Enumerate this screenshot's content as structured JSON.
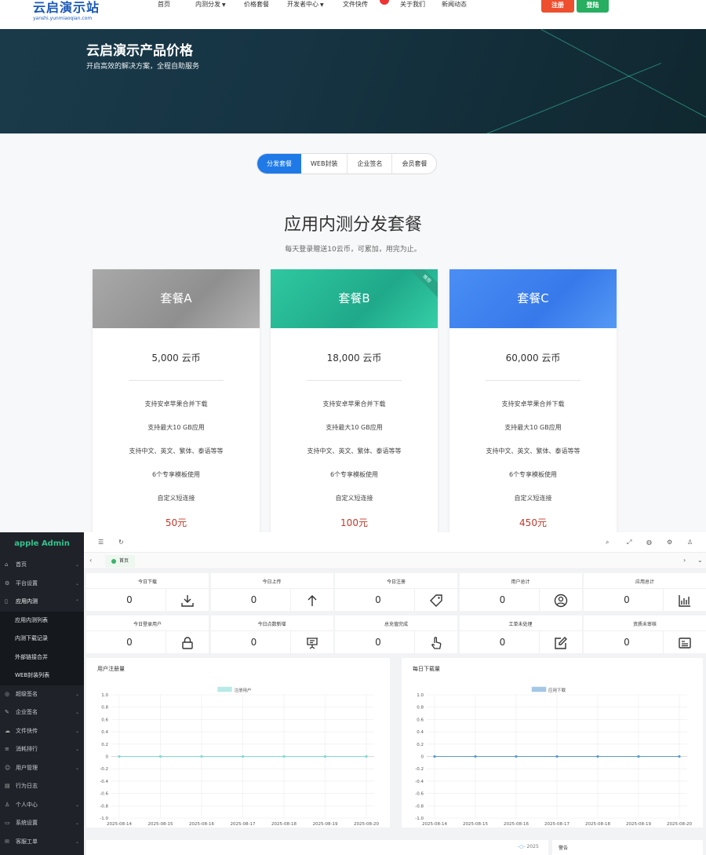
{
  "site": {
    "logo_title": "云启演示站",
    "logo_sub": "yanshi.yunmiaoqian.com",
    "nav": [
      "首页",
      "内测分发",
      "价格套餐",
      "开发者中心",
      "文件快传",
      "关于我们",
      "新闻动态"
    ],
    "register_label": "注册",
    "login_label": "登陆"
  },
  "hero": {
    "title": "云启演示产品价格",
    "subtitle": "开启高效的解决方案，全程自助服务"
  },
  "tabs": [
    "分发套餐",
    "WEB封装",
    "企业签名",
    "会员套餐"
  ],
  "section": {
    "title": "应用内测分发套餐",
    "subtitle": "每天登录赠送10云币，可累加，用完为止。"
  },
  "plans": [
    {
      "name": "套餐A",
      "price": "5,000 云币",
      "cost": "50元",
      "ribbon": ""
    },
    {
      "name": "套餐B",
      "price": "18,000 云币",
      "cost": "100元",
      "ribbon": "推荐"
    },
    {
      "name": "套餐C",
      "price": "60,000 云币",
      "cost": "450元",
      "ribbon": ""
    }
  ],
  "features": [
    "支持安卓苹果合并下载",
    "支持最大10 GB应用",
    "支持中文、英文、繁体、泰语等等",
    "6个专享模板使用",
    "自定义短连接"
  ],
  "admin": {
    "title": "apple Admin",
    "menu": [
      {
        "label": "首页",
        "icon": "home-icon"
      },
      {
        "label": "平台设置",
        "icon": "gear-icon"
      },
      {
        "label": "应用内测",
        "icon": "phone-icon"
      }
    ],
    "submenu": [
      "应用内测列表",
      "内测下载记录",
      "外部链接合并",
      "WEB封装列表"
    ],
    "menu2": [
      "超级签名",
      "企业签名",
      "文件快传",
      "消耗排行",
      "用户管理",
      "行为日志",
      "个人中心",
      "系统设置",
      "客服工单"
    ],
    "home_tab": "首页",
    "stats": [
      {
        "label": "今日下载",
        "value": "0",
        "icon": "download-icon"
      },
      {
        "label": "今日上传",
        "value": "0",
        "icon": "upload-icon"
      },
      {
        "label": "今日注册",
        "value": "0",
        "icon": "tag-icon"
      },
      {
        "label": "用户总计",
        "value": "0",
        "icon": "user-circle-icon"
      },
      {
        "label": "应用总计",
        "value": "0",
        "icon": "bar-chart-icon"
      },
      {
        "label": "今日登录用户",
        "value": "0",
        "icon": "lock-icon"
      },
      {
        "label": "今日点数新增",
        "value": "0",
        "icon": "presentation-icon"
      },
      {
        "label": "总充值完成",
        "value": "0",
        "icon": "hand-pointer-icon"
      },
      {
        "label": "工单未处理",
        "value": "0",
        "icon": "edit-icon"
      },
      {
        "label": "资质未审核",
        "value": "0",
        "icon": "id-card-icon"
      }
    ],
    "bottom_legend": "2025",
    "bottom_title": "警告"
  },
  "chart_data": [
    {
      "type": "line",
      "title": "用户注册量",
      "x": [
        "2025-08-14",
        "2025-08-15",
        "2025-08-16",
        "2025-08-17",
        "2025-08-18",
        "2025-08-19",
        "2025-08-20"
      ],
      "series": [
        {
          "name": "注册用户",
          "values": [
            0,
            0,
            0,
            0,
            0,
            0,
            0
          ]
        }
      ],
      "ylim": [
        -1.0,
        1.0
      ],
      "yticks": [
        "1.0",
        "0.8",
        "0.6",
        "0.4",
        "0.2",
        "0",
        "-0.2",
        "-0.4",
        "-0.6",
        "-0.8",
        "-1.0"
      ],
      "grid": true,
      "legend": "top-center",
      "color": "#7fd9d3"
    },
    {
      "type": "line",
      "title": "每日下载量",
      "x": [
        "2025-08-14",
        "2025-08-15",
        "2025-08-16",
        "2025-08-17",
        "2025-08-18",
        "2025-08-19",
        "2025-08-20"
      ],
      "series": [
        {
          "name": "应用下载",
          "values": [
            0,
            0,
            0,
            0,
            0,
            0,
            0
          ]
        }
      ],
      "ylim": [
        -1.0,
        1.0
      ],
      "yticks": [
        "1.0",
        "0.8",
        "0.6",
        "0.4",
        "0.2",
        "0",
        "-0.2",
        "-0.4",
        "-0.6",
        "-0.8",
        "-1.0"
      ],
      "grid": true,
      "legend": "top-center",
      "color": "#5b9bd5"
    }
  ]
}
